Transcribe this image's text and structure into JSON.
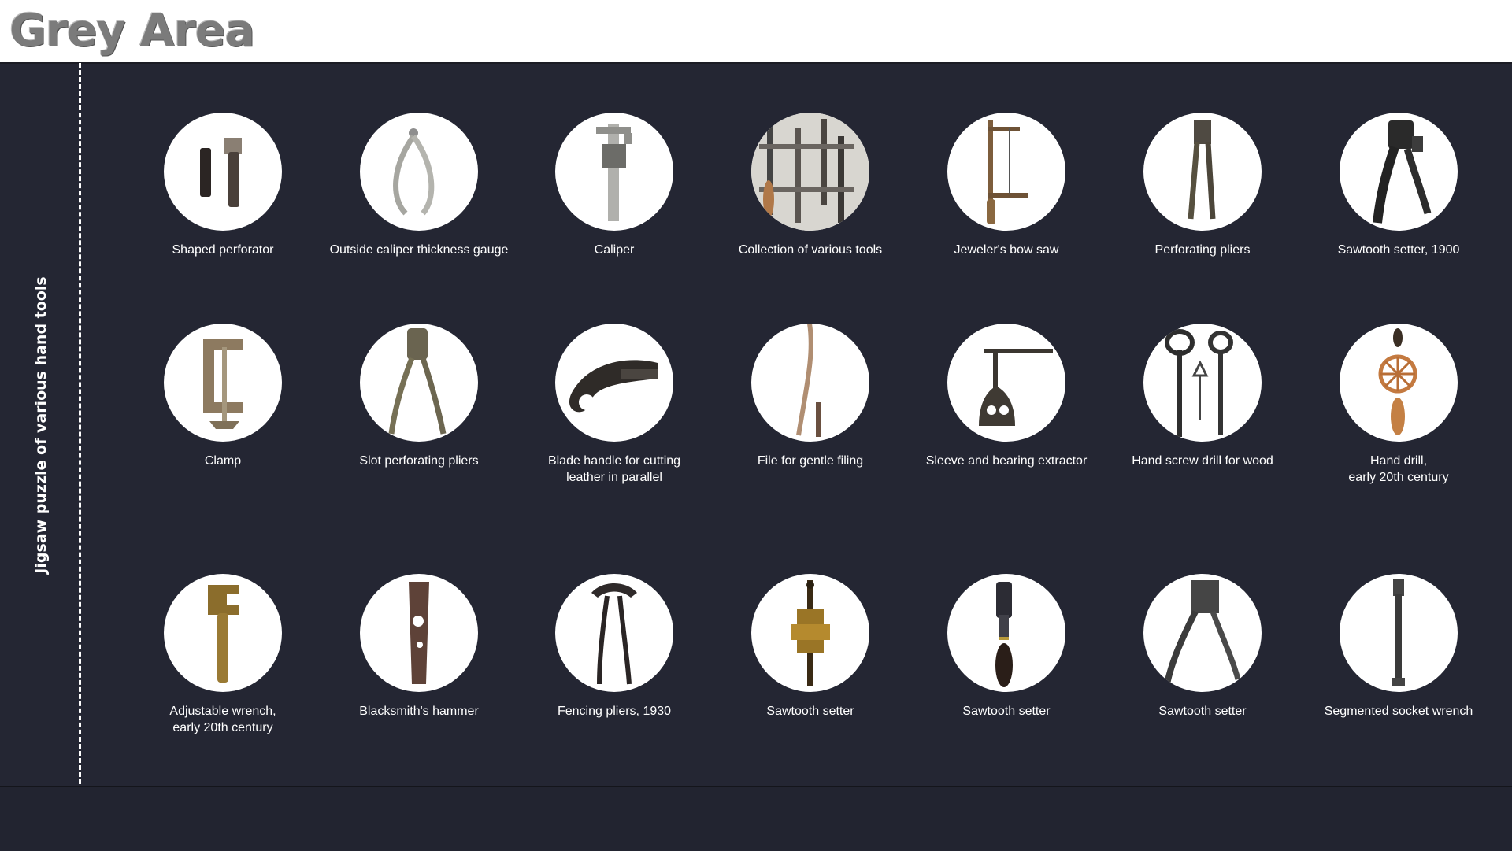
{
  "header": {
    "brand": "Grey Area"
  },
  "sidebar": {
    "caption": "Jigsaw puzzle of various hand tools"
  },
  "tools": [
    {
      "label": "Shaped perforator",
      "icon": "perforator-icon"
    },
    {
      "label": "Outside caliper thickness gauge",
      "icon": "outside-caliper-icon"
    },
    {
      "label": "Caliper",
      "icon": "caliper-icon"
    },
    {
      "label": "Collection of various tools",
      "icon": "tool-collection-icon"
    },
    {
      "label": "Jeweler's bow saw",
      "icon": "bow-saw-icon"
    },
    {
      "label": "Perforating pliers",
      "icon": "perforating-pliers-icon"
    },
    {
      "label": "Sawtooth setter, 1900",
      "icon": "sawtooth-setter-icon"
    },
    {
      "label": "Clamp",
      "icon": "clamp-icon"
    },
    {
      "label": "Slot perforating pliers",
      "icon": "slot-pliers-icon"
    },
    {
      "label": "Blade handle for cutting\nleather in parallel",
      "icon": "blade-handle-icon"
    },
    {
      "label": "File for gentle filing",
      "icon": "file-icon"
    },
    {
      "label": "Sleeve and bearing extractor",
      "icon": "bearing-extractor-icon"
    },
    {
      "label": "Hand screw drill for wood",
      "icon": "screw-drill-icon"
    },
    {
      "label": "Hand drill,\nearly 20th century",
      "icon": "hand-drill-icon"
    },
    {
      "label": "Adjustable wrench,\nearly 20th century",
      "icon": "adjustable-wrench-icon"
    },
    {
      "label": "Blacksmith's hammer",
      "icon": "hammer-icon"
    },
    {
      "label": "Fencing pliers, 1930",
      "icon": "fencing-pliers-icon"
    },
    {
      "label": "Sawtooth setter",
      "icon": "sawtooth-setter-icon"
    },
    {
      "label": "Sawtooth setter",
      "icon": "sawtooth-setter-icon"
    },
    {
      "label": "Sawtooth setter",
      "icon": "sawtooth-setter-icon"
    },
    {
      "label": "Segmented socket wrench",
      "icon": "socket-wrench-icon"
    }
  ]
}
